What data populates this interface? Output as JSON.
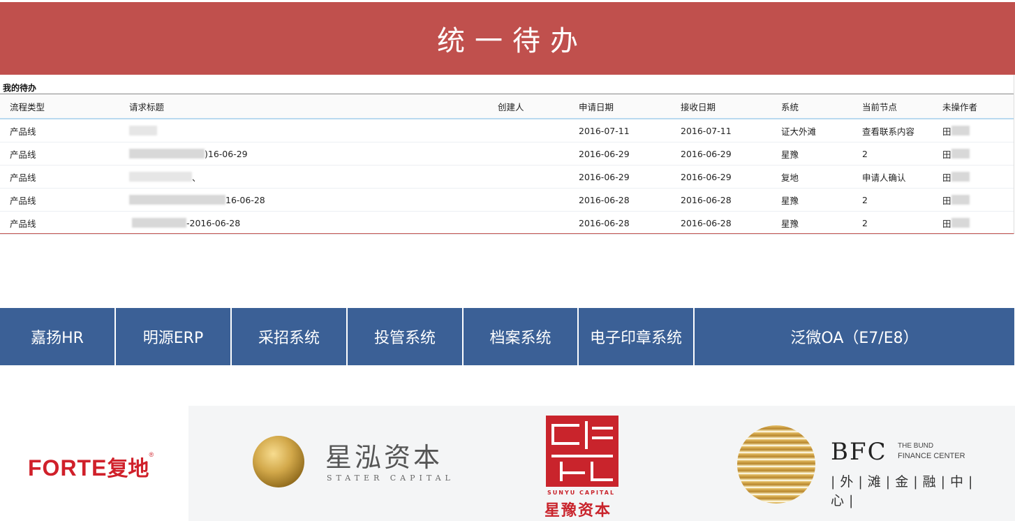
{
  "banner": {
    "title": "统一待办"
  },
  "todo": {
    "caption": "我的待办",
    "headers": {
      "type": "流程类型",
      "title": "请求标题",
      "creator": "创建人",
      "apply_date": "申请日期",
      "recv_date": "接收日期",
      "system": "系统",
      "node": "当前节点",
      "operator": "未操作者"
    },
    "rows": [
      {
        "type": "产品线",
        "title_visible": "",
        "apply_date": "2016-07-11",
        "recv_date": "2016-07-11",
        "system": "证大外滩",
        "node": "查看联系内容",
        "operator": "田"
      },
      {
        "type": "产品线",
        "title_visible": ")16-06-29",
        "apply_date": "2016-06-29",
        "recv_date": "2016-06-29",
        "system": "星豫",
        "node": "2",
        "operator": "田"
      },
      {
        "type": "产品线",
        "title_visible": "、",
        "apply_date": "2016-06-29",
        "recv_date": "2016-06-29",
        "system": "复地",
        "node": "申请人确认",
        "operator": "田"
      },
      {
        "type": "产品线",
        "title_visible": "16-06-28",
        "apply_date": "2016-06-28",
        "recv_date": "2016-06-28",
        "system": "星豫",
        "node": "2",
        "operator": "田"
      },
      {
        "type": "产品线",
        "title_visible": "-2016-06-28",
        "apply_date": "2016-06-28",
        "recv_date": "2016-06-28",
        "system": "星豫",
        "node": "2",
        "operator": "田"
      }
    ]
  },
  "nav": [
    {
      "label": "嘉扬HR"
    },
    {
      "label": "明源ERP"
    },
    {
      "label": "采招系统"
    },
    {
      "label": "投管系统"
    },
    {
      "label": "档案系统"
    },
    {
      "label": "电子印章系统"
    },
    {
      "label": "泛微OA（E7/E8）"
    }
  ],
  "logos": {
    "forte": {
      "text": "FORTE",
      "cn": "复地",
      "mark": "®"
    },
    "stater": {
      "cn": "星泓资本",
      "en": "STATER CAPITAL"
    },
    "xingyu": {
      "en": "SUNYU CAPITAL",
      "cn": "星豫资本"
    },
    "bfc": {
      "big": "BFC",
      "small1": "THE BUND",
      "small2": "FINANCE CENTER",
      "cn": "|外|滩|金|融|中|心|"
    }
  },
  "colors": {
    "banner": "#c0504d",
    "nav": "#3b6096",
    "accent_red": "#d0202a"
  }
}
